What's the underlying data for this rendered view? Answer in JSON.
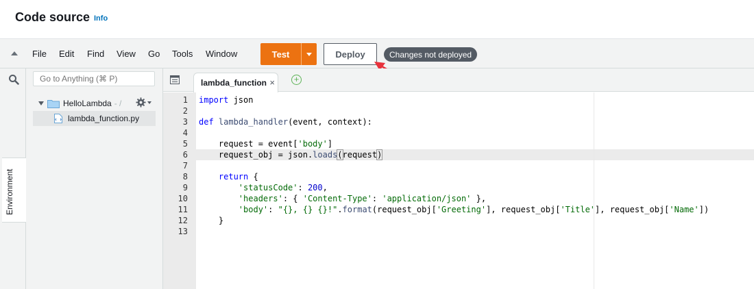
{
  "header": {
    "title": "Code source",
    "info": "Info"
  },
  "menu": [
    "File",
    "Edit",
    "Find",
    "View",
    "Go",
    "Tools",
    "Window"
  ],
  "toolbar": {
    "test_label": "Test",
    "deploy_label": "Deploy",
    "status_badge": "Changes not deployed"
  },
  "sidebar": {
    "tab_label": "Environment"
  },
  "tree": {
    "goto_placeholder": "Go to Anything (⌘ P)",
    "folder": "HelloLambda",
    "folder_sep": "- /",
    "file": "lambda_function.py"
  },
  "editor": {
    "tab_label": "lambda_function",
    "close_glyph": "×",
    "add_glyph": "+",
    "line_numbers": [
      "1",
      "2",
      "3",
      "4",
      "5",
      "6",
      "7",
      "8",
      "9",
      "10",
      "11",
      "12",
      "13"
    ]
  },
  "icons": {
    "search": "search-icon",
    "gear": "gear-icon",
    "folder": "folder-icon",
    "file": "python-file-icon",
    "arrow": "red-arrow-annotation",
    "accent": "#ec7211",
    "badge": "#545b64"
  }
}
